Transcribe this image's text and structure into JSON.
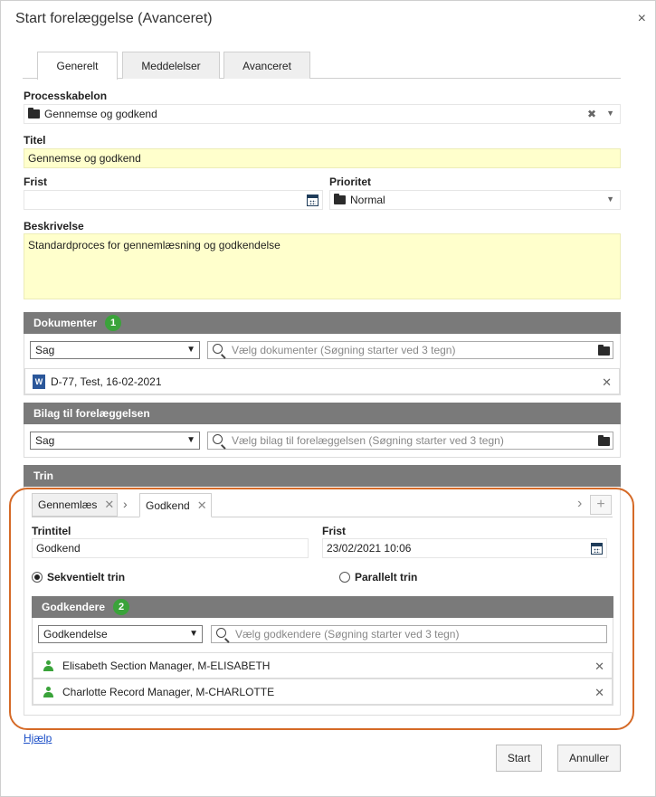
{
  "dialog": {
    "title": "Start forelæggelse (Avanceret)",
    "close_symbol": "×"
  },
  "tabs": [
    {
      "label": "Generelt",
      "active": true
    },
    {
      "label": "Meddelelser",
      "active": false
    },
    {
      "label": "Avanceret",
      "active": false
    }
  ],
  "form": {
    "template_label": "Processkabelon",
    "template_value": "Gennemse og godkend",
    "title_label": "Titel",
    "title_value": "Gennemse og godkend",
    "deadline_label": "Frist",
    "deadline_value": "",
    "priority_label": "Prioritet",
    "priority_value": "Normal",
    "description_label": "Beskrivelse",
    "description_value": "Standardproces for gennemlæsning og godkendelse"
  },
  "documents": {
    "header": "Dokumenter",
    "count": "1",
    "source_select": "Sag",
    "search_placeholder": "Vælg dokumenter (Søgning starter ved 3 tegn)",
    "items": [
      {
        "label": "D-77, Test, 16-02-2021",
        "icon": "word-icon"
      }
    ]
  },
  "attachments": {
    "header": "Bilag til forelæggelsen",
    "source_select": "Sag",
    "search_placeholder": "Vælg bilag til forelæggelsen (Søgning starter ved 3 tegn)"
  },
  "steps": {
    "header": "Trin",
    "step_tabs": [
      "Gennemlæs",
      "Godkend"
    ],
    "step_title_label": "Trintitel",
    "step_title_value": "Godkend",
    "step_deadline_label": "Frist",
    "step_deadline_value": "23/02/2021 10:06",
    "radio_sequential": "Sekventielt trin",
    "radio_parallel": "Parallelt trin",
    "approvers": {
      "header": "Godkendere",
      "count": "2",
      "type_select": "Godkendelse",
      "search_placeholder": "Vælg godkendere (Søgning starter ved 3 tegn)",
      "items": [
        {
          "label": "Elisabeth Section Manager, M-ELISABETH"
        },
        {
          "label": "Charlotte Record Manager, M-CHARLOTTE"
        }
      ]
    }
  },
  "footer": {
    "help_link": "Hjælp",
    "start_button": "Start",
    "cancel_button": "Annuller"
  },
  "colors": {
    "section_header": "#7a7a7a",
    "badge": "#3aa33a",
    "highlight_border": "#d56a27",
    "required_field": "#ffffcc"
  }
}
